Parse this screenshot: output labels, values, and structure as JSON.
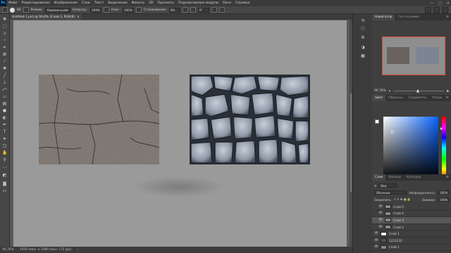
{
  "menubar": {
    "logo": "Ps",
    "items": [
      "Файл",
      "Редактирование",
      "Изображение",
      "Слои",
      "Текст",
      "Выделение",
      "Фильтр",
      "3D",
      "Просмотр",
      "Подключаемые модули",
      "Окно",
      "Справка"
    ],
    "controls": [
      "—",
      "□",
      "✕"
    ]
  },
  "options": {
    "brush_size": "69",
    "mode_label": "Режим:",
    "mode_value": "Нормальный",
    "opacity_label": "Непрозр.:",
    "opacity_value": "100%",
    "flow_label": "Наж.:",
    "flow_value": "100%",
    "smoothing_label": "Сглаживание:",
    "smoothing_value": "0%",
    "angle_value": "0°"
  },
  "document": {
    "tab_label": "Untitled-1.psd @ 90,8% (Слой 3, RGB/8)",
    "tab_close": "×"
  },
  "status": {
    "zoom": "90,78%",
    "doc_size": "1920 пикс. x 1080 пикс. (72 ppi)"
  },
  "panels": {
    "navigator_tabs": [
      "Навигатор",
      "Гистограмма"
    ],
    "navigator_zoom": "90,78%",
    "color_tabs": [
      "Цвет",
      "Образцы",
      "Градиенты",
      "Узоры"
    ],
    "layers_tabs": [
      "Слои",
      "Каналы",
      "Контуры"
    ],
    "layers_filter": "Вид",
    "blend_mode": "Обычные",
    "opacity_label": "Непрозрачность:",
    "opacity_value": "100%",
    "lock_label": "Закрепить:",
    "fill_label": "Заливка:",
    "fill_value": "100%",
    "panel_menu": "≡"
  },
  "layers": [
    {
      "name": "Слой 5",
      "thumb": "gray"
    },
    {
      "name": "Слой 4",
      "thumb": "gray"
    },
    {
      "name": "Слой 3",
      "thumb": "gray",
      "selected": true
    },
    {
      "name": "Слой 2",
      "thumb": "gray"
    },
    {
      "name": "Слой 1",
      "thumb": "white"
    },
    {
      "name": "1231232",
      "thumb": "dark"
    },
    {
      "name": "Слой 1",
      "thumb": "gray"
    }
  ],
  "colors": {
    "accent": "#31a8ff",
    "nav_frame": "#e2533a",
    "canvas": "#9a9a9a"
  },
  "icons": {
    "eye": "eye-icon",
    "toolbar": [
      "move-icon",
      "marquee-icon",
      "lasso-icon",
      "quick-select-icon",
      "crop-icon",
      "frame-icon",
      "eyedropper-icon",
      "healing-icon",
      "brush-icon",
      "stamp-icon",
      "history-brush-icon",
      "eraser-icon",
      "gradient-icon",
      "blur-icon",
      "dodge-icon",
      "pen-icon",
      "type-icon",
      "path-select-icon",
      "rectangle-icon",
      "hand-icon",
      "zoom-icon",
      "more-icon",
      "color-swatch-icon",
      "quickmask-icon",
      "screen-mode-icon"
    ]
  }
}
